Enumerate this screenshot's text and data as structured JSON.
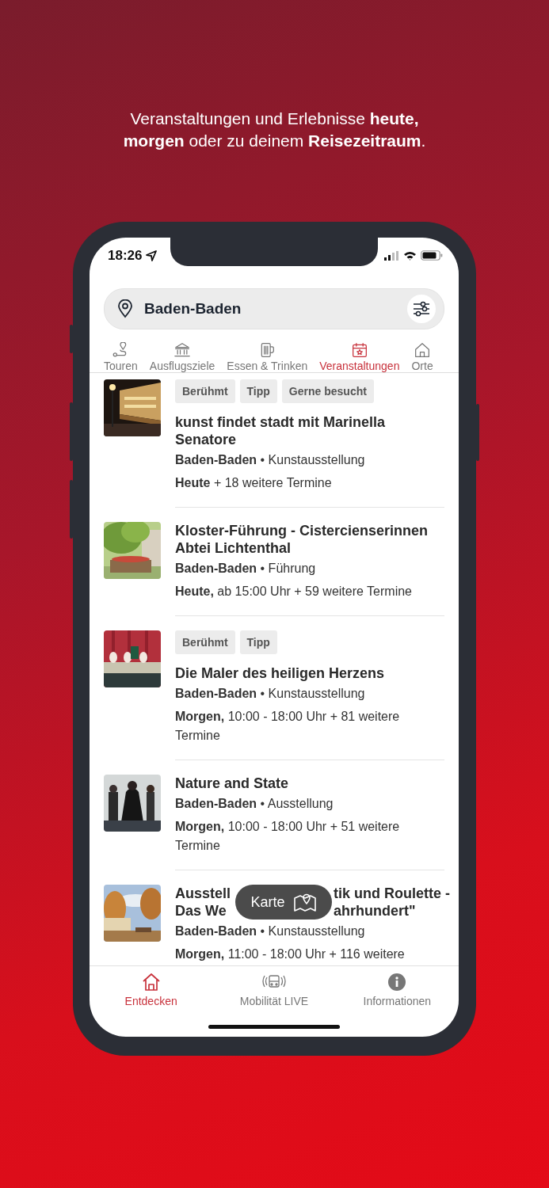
{
  "headline": "Veranstaltungen und Erlebnisse **heute,** **morgen** oder zu deinem **Reisezeitraum**.",
  "status_bar": {
    "time": "18:26"
  },
  "search": {
    "value": "Baden-Baden"
  },
  "tabs": [
    {
      "label": "Touren",
      "selected": false
    },
    {
      "label": "Ausflugsziele",
      "selected": false
    },
    {
      "label": "Essen & Trinken",
      "selected": false
    },
    {
      "label": "Veranstaltungen",
      "selected": true
    },
    {
      "label": "Orte",
      "selected": false
    }
  ],
  "events": [
    {
      "tags": [
        "Berühmt",
        "Tipp",
        "Gerne besucht"
      ],
      "title": "kunst findet stadt mit Marinella Senatore",
      "meta": "**Baden-Baden** • Kunstausstellung",
      "date": "**Heute** + 18 weitere Termine"
    },
    {
      "title": "Kloster-Führung - Cistercienserinnen Abtei Lichtenthal",
      "meta": "**Baden-Baden** • Führung",
      "date": "**Heute,** ab 15:00 Uhr + 59 weitere Termine"
    },
    {
      "tags": [
        "Berühmt",
        "Tipp"
      ],
      "title": "Die Maler des heiligen Herzens",
      "meta": "**Baden-Baden** • Kunstausstellung",
      "date": "**Morgen,** 10:00 - 18:00 Uhr + 81 weitere Termine"
    },
    {
      "title": "Nature and State",
      "meta": "**Baden-Baden** • Ausstellung",
      "date": "**Morgen,** 10:00 - 18:00 Uhr + 51 weitere Termine"
    },
    {
      "title_parts": [
        {
          "left": "Ausstell",
          "right": "tik und Roulette -"
        },
        {
          "left": "Das We",
          "right": "ahrhundert\""
        }
      ],
      "meta": "**Baden-Baden** • Kunstausstellung",
      "date": "**Morgen,** 11:00 - 18:00 Uhr + 116 weitere"
    }
  ],
  "map_button": {
    "label": "Karte"
  },
  "bottom_nav": [
    {
      "label": "Entdecken",
      "selected": true
    },
    {
      "label": "Mobilität LIVE",
      "selected": false
    },
    {
      "label": "Informationen",
      "selected": false
    }
  ]
}
